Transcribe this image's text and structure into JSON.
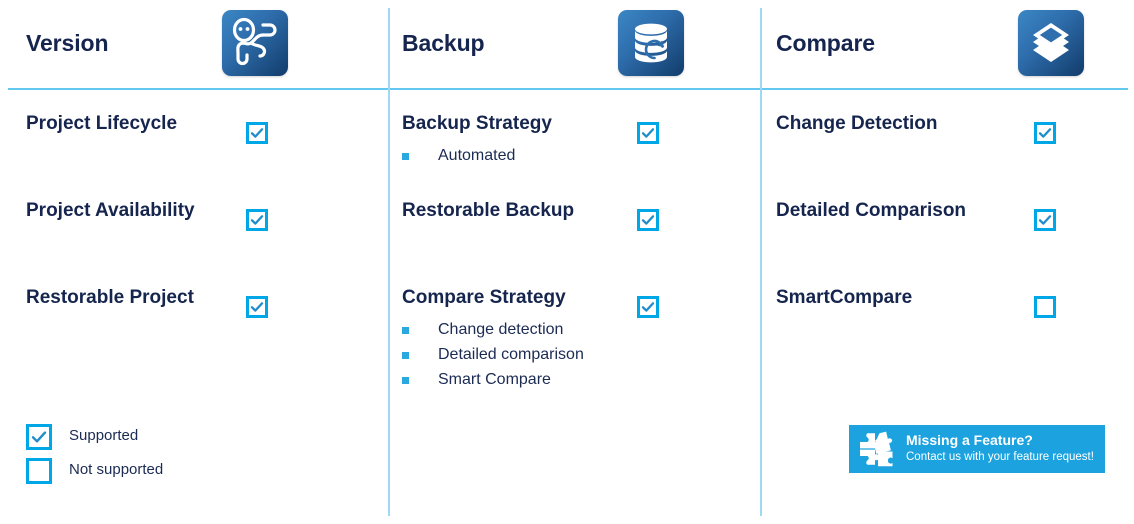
{
  "colors": {
    "title_navy": "#16254e",
    "checkbox_blue": "#00a7e6",
    "check_mark": "#1f8ccc",
    "divider_h": "#63c8ef",
    "divider_v": "#9ed8f2",
    "bullet": "#2aa8e0",
    "banner_bg": "#1ca3df",
    "icon_gradient_from": "#3b86c4",
    "icon_gradient_to": "#123c6b"
  },
  "columns": [
    {
      "title": "Version",
      "icon": "version-branch-icon",
      "features": [
        {
          "label": "Project Lifecycle",
          "supported": true,
          "bullets": []
        },
        {
          "label": "Project Availability",
          "supported": true,
          "bullets": []
        },
        {
          "label": "Restorable Project",
          "supported": true,
          "bullets": []
        }
      ]
    },
    {
      "title": "Backup",
      "icon": "database-restore-icon",
      "features": [
        {
          "label": "Backup Strategy",
          "supported": true,
          "bullets": [
            "Automated"
          ]
        },
        {
          "label": "Restorable Backup",
          "supported": true,
          "bullets": []
        },
        {
          "label": "Compare Strategy",
          "supported": true,
          "bullets": [
            "Change detection",
            "Detailed comparison",
            "Smart Compare"
          ]
        }
      ]
    },
    {
      "title": "Compare",
      "icon": "layers-stack-icon",
      "features": [
        {
          "label": "Change Detection",
          "supported": true,
          "bullets": []
        },
        {
          "label": "Detailed Comparison",
          "supported": true,
          "bullets": []
        },
        {
          "label": "SmartCompare",
          "supported": false,
          "bullets": []
        }
      ]
    }
  ],
  "legend": {
    "supported_label": "Supported",
    "not_supported_label": "Not supported"
  },
  "banner": {
    "icon": "puzzle-pieces-icon",
    "title": "Missing a Feature?",
    "subtitle": "Contact us with your feature request!"
  }
}
